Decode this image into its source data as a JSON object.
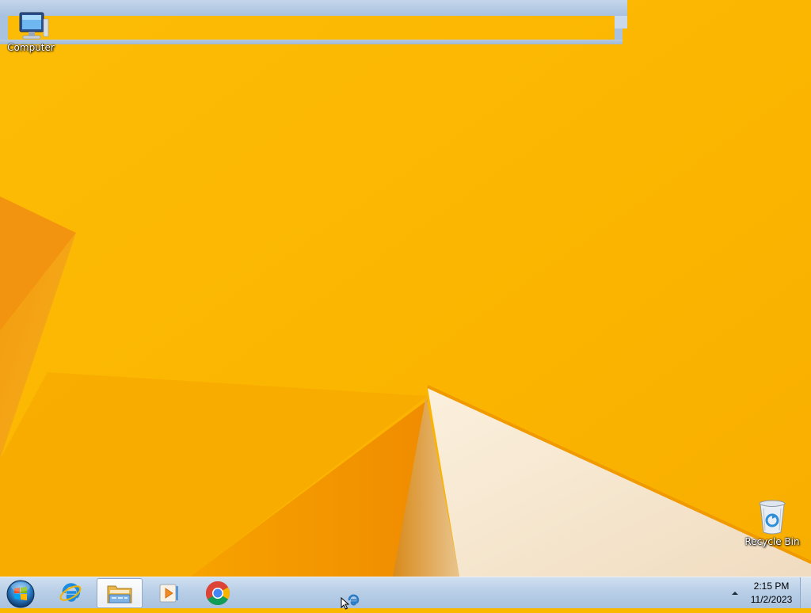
{
  "desktop": {
    "icons": [
      {
        "label": "Computer",
        "icon": "computer-icon"
      },
      {
        "label": "Recycle Bin",
        "icon": "recycle-bin-icon"
      }
    ],
    "wallpaper_colors": {
      "base": "#fbb800",
      "accent_orange": "#f08c00",
      "paper": "#f3e6d2"
    }
  },
  "taskbar": {
    "start_icon": "windows-orb-icon",
    "pinned": [
      {
        "name": "Internet Explorer",
        "icon": "internet-explorer-icon",
        "active": false
      },
      {
        "name": "Windows Explorer",
        "icon": "file-explorer-icon",
        "active": true
      },
      {
        "name": "Windows Media Player",
        "icon": "media-player-icon",
        "active": false
      },
      {
        "name": "Google Chrome",
        "icon": "chrome-icon",
        "active": false
      }
    ],
    "tray": {
      "chevron_icon": "show-hidden-icons-icon",
      "time": "2:15 PM",
      "date": "11/2/2023"
    }
  }
}
